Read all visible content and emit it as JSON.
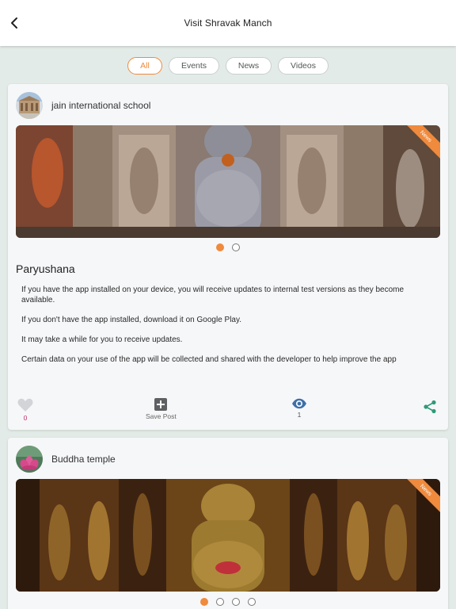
{
  "appbar": {
    "title": "Visit Shravak Manch",
    "back_icon": "chevron-left-icon"
  },
  "filters": [
    {
      "label": "All",
      "active": true
    },
    {
      "label": "Events",
      "active": false
    },
    {
      "label": "News",
      "active": false
    },
    {
      "label": "Videos",
      "active": false
    }
  ],
  "colors": {
    "accent": "#f08a3c",
    "like": "#c0306a",
    "view": "#3f6fa8",
    "share": "#2e9a78",
    "background": "#e3ebe8"
  },
  "posts": [
    {
      "author": "jain international school",
      "ribbon": "News",
      "slide_count": 2,
      "active_slide": 1,
      "title": "Paryushana",
      "body": [
        "If you have the app installed on your device, you will receive updates to internal test versions as they become available.",
        "If you don't have the app installed, download it on Google Play.",
        "It may take a while for you to receive updates.",
        "Certain data on your use of the app will be collected and shared with the developer to help improve the app"
      ],
      "likes": "0",
      "save_label": "Save Post",
      "views": "1"
    },
    {
      "author": "Buddha temple",
      "ribbon": "News",
      "slide_count": 4,
      "active_slide": 1
    }
  ]
}
